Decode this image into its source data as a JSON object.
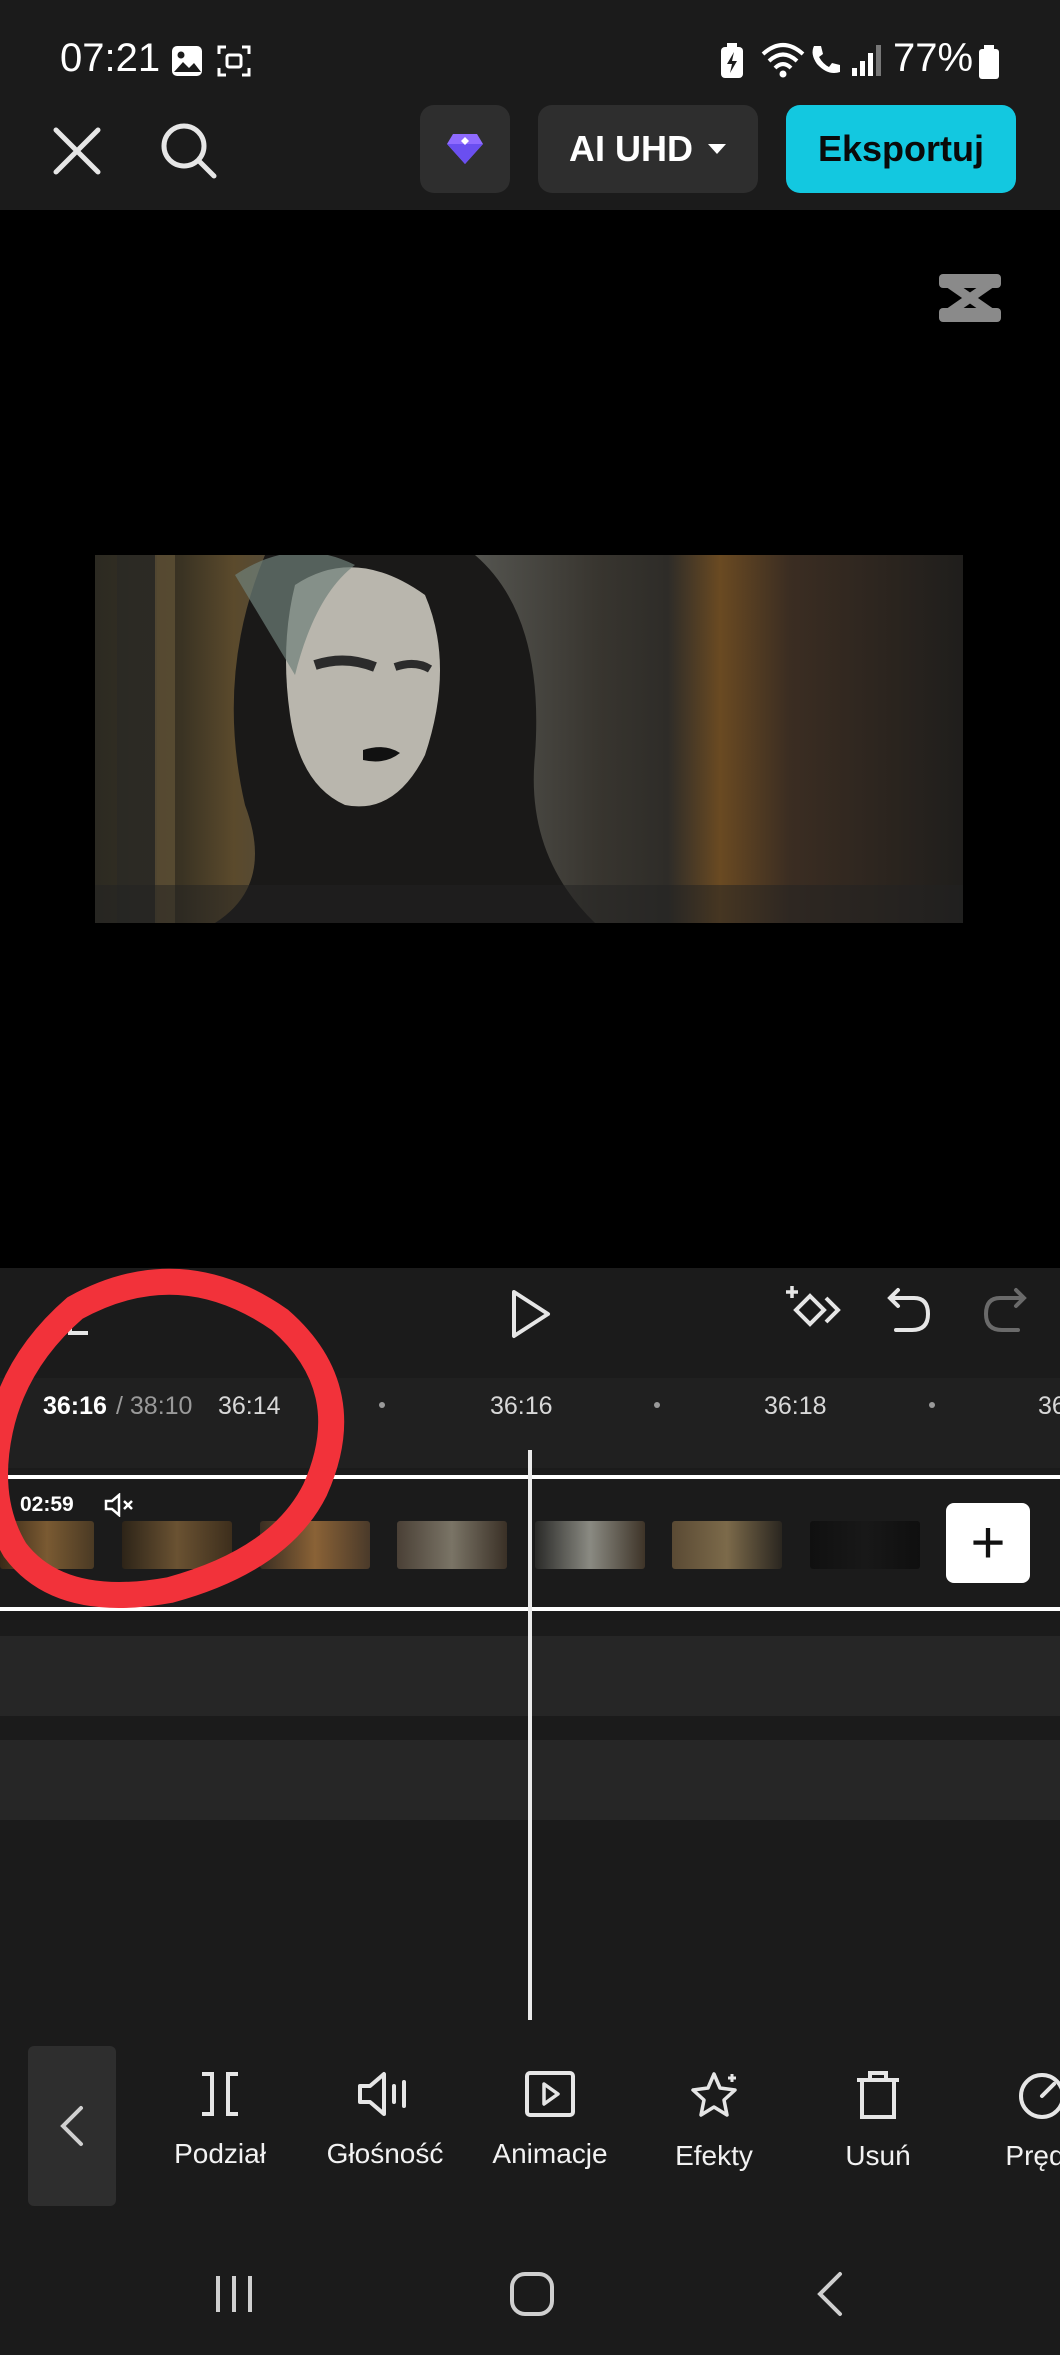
{
  "status_bar": {
    "time": "07:21",
    "battery_percent": "77%"
  },
  "toolbar": {
    "quality_label": "AI UHD",
    "export_label": "Eksportuj",
    "accent_color": "#13c8e0"
  },
  "timeline": {
    "current_time": "36:16",
    "total_time": "/ 38:10",
    "ruler_ticks": [
      "36:14",
      "36:16",
      "36:18",
      "36"
    ],
    "clip_duration": "02:59"
  },
  "bottom_tools": [
    {
      "label": "Podział",
      "icon": "split-icon"
    },
    {
      "label": "Głośność",
      "icon": "volume-icon"
    },
    {
      "label": "Animacje",
      "icon": "animation-icon"
    },
    {
      "label": "Efekty",
      "icon": "effects-icon"
    },
    {
      "label": "Usuń",
      "icon": "delete-icon"
    },
    {
      "label": "Prędk",
      "icon": "speed-icon"
    }
  ],
  "annotation_color": "#f2323a"
}
